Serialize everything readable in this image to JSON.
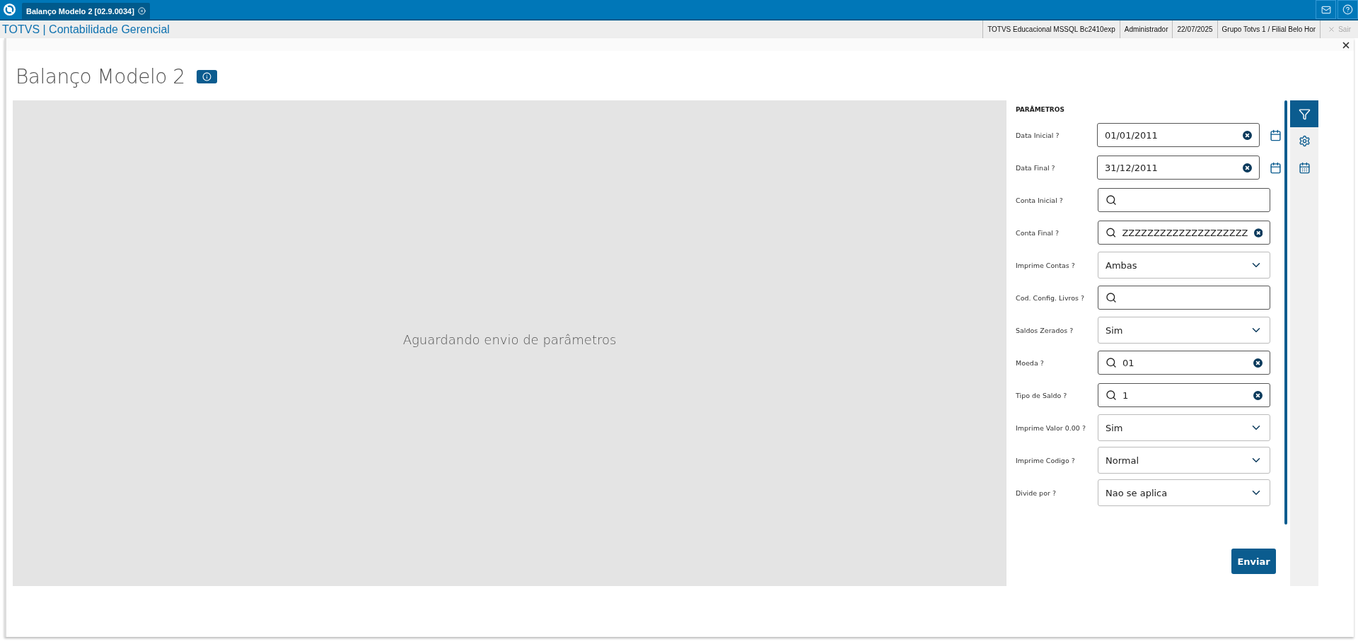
{
  "tabs": [
    {
      "label": "Balanço Modelo 2 [02.9.0034]",
      "selected": true
    }
  ],
  "header": {
    "app_title": "TOTVS | Contabilidade Gerencial",
    "info": [
      "TOTVS Educacional MSSQL Bc2410exp",
      "Administrador",
      "22/07/2025",
      "Grupo Totvs 1 / Filial Belo Hor"
    ],
    "logout": "Sair"
  },
  "page": {
    "title": "Balanço Modelo 2",
    "message": "Aguardando envio de parâmetros"
  },
  "parameters": {
    "heading": "PARÂMETROS",
    "fields": [
      {
        "kind": "date",
        "label": "Data Inicial ?",
        "value": "01/01/2011"
      },
      {
        "kind": "date",
        "label": "Data Final ?",
        "value": "31/12/2011"
      },
      {
        "kind": "lookup",
        "label": "Conta Inicial ?"
      },
      {
        "kind": "lookup",
        "label": "Conta Final ?",
        "value": "ZZZZZZZZZZZZZZZZZZZZ"
      },
      {
        "kind": "select",
        "label": "Imprime Contas ?",
        "value": "Ambas"
      },
      {
        "kind": "lookup",
        "label": "Cod. Config. Livros ?"
      },
      {
        "kind": "select",
        "label": "Saldos Zerados ?",
        "value": "Sim"
      },
      {
        "kind": "lookup",
        "label": "Moeda ?",
        "value": "01"
      },
      {
        "kind": "lookup",
        "label": "Tipo de Saldo ?",
        "value": "1"
      },
      {
        "kind": "select",
        "label": "Imprime Valor 0.00 ?",
        "value": "Sim"
      },
      {
        "kind": "select",
        "label": "Imprime Codigo ?",
        "value": "Normal"
      },
      {
        "kind": "select",
        "label": "Divide por ?",
        "value": "Nao se aplica"
      }
    ],
    "submit": "Enviar"
  },
  "side_tools": [
    {
      "kind": "filter",
      "selected": true
    },
    {
      "kind": "settings",
      "selected": false
    },
    {
      "kind": "calendar",
      "selected": false
    }
  ]
}
